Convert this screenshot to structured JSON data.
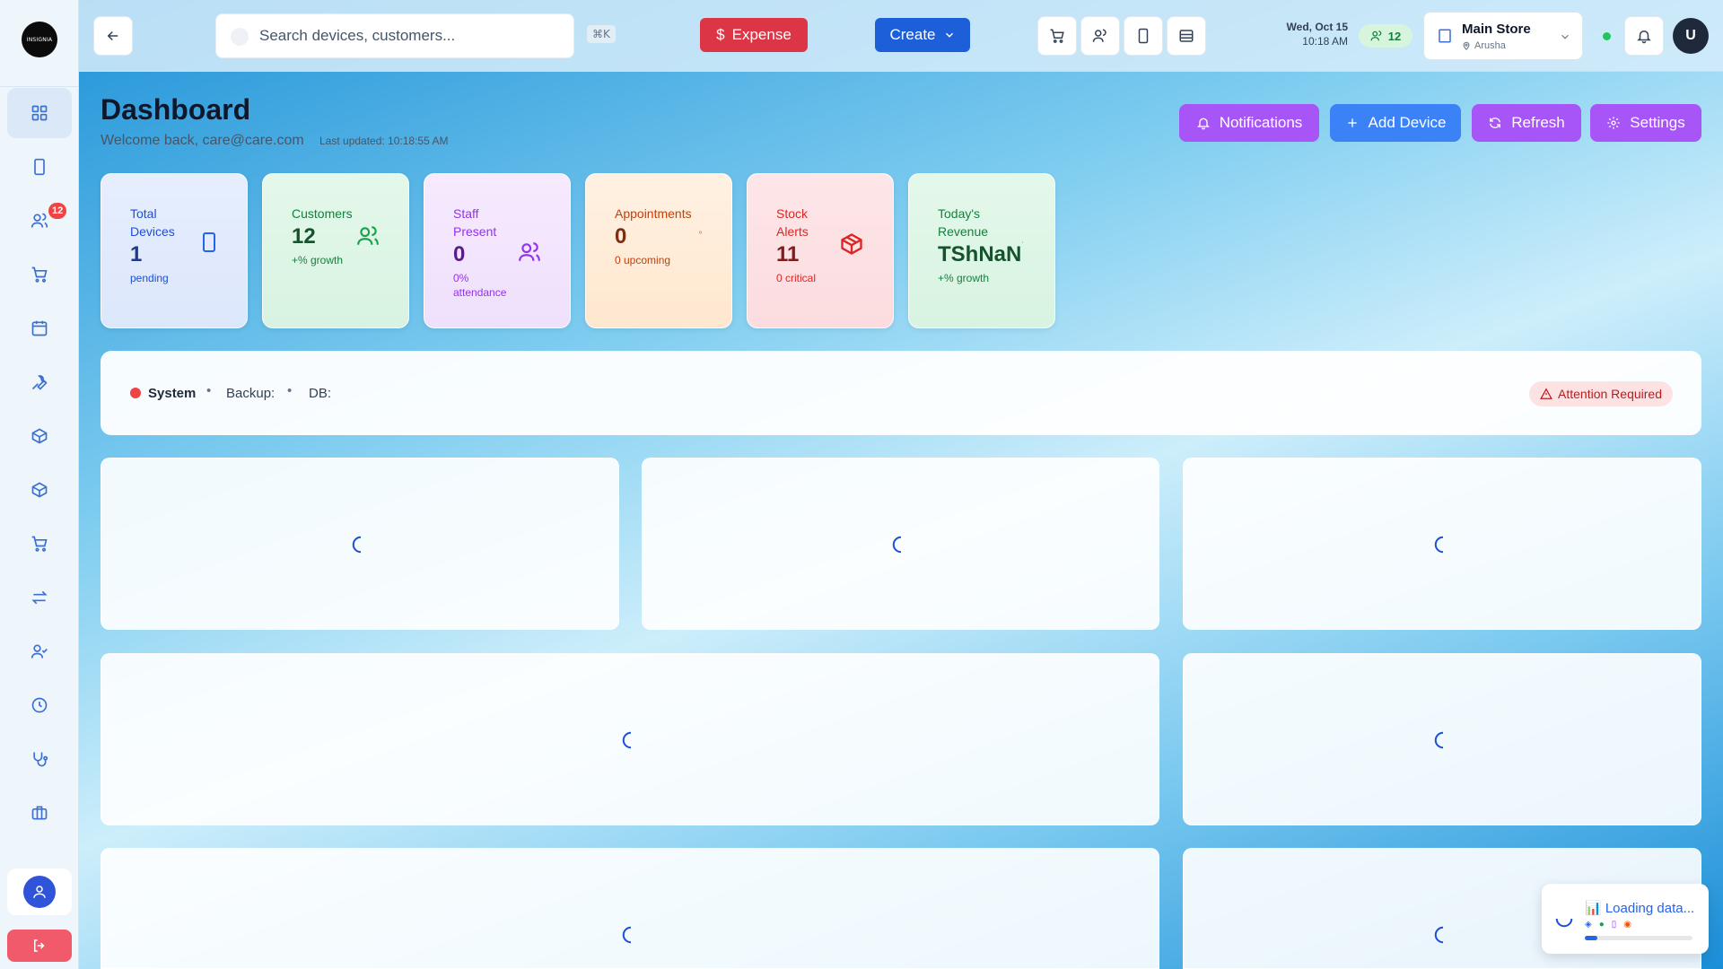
{
  "sidebar": {
    "logo_text": "INSIGNIA",
    "items": [
      {
        "icon": "dashboard-grid-icon",
        "active": true
      },
      {
        "icon": "smartphone-icon"
      },
      {
        "icon": "users-icon",
        "badge": "12"
      },
      {
        "icon": "shopping-cart-icon"
      },
      {
        "icon": "calendar-icon"
      },
      {
        "icon": "wrench-icon"
      },
      {
        "icon": "package-icon"
      },
      {
        "icon": "box-icon"
      },
      {
        "icon": "cart-icon"
      },
      {
        "icon": "transfer-arrows-icon"
      },
      {
        "icon": "user-check-icon"
      },
      {
        "icon": "clock-icon"
      },
      {
        "icon": "stethoscope-icon"
      },
      {
        "icon": "briefcase-icon"
      }
    ]
  },
  "topbar": {
    "search_placeholder": "Search devices, customers...",
    "shortcut": "⌘K",
    "expense_label": "Expense",
    "create_label": "Create",
    "date": "Wed, Oct 15",
    "time": "10:18 AM",
    "online_count": "12",
    "store_name": "Main Store",
    "store_location": "Arusha",
    "user_initial": "U"
  },
  "header": {
    "title": "Dashboard",
    "welcome": "Welcome back, care@care.com",
    "last_updated": "Last updated: 10:18:55 AM",
    "actions": {
      "notifications": "Notifications",
      "add_device": "Add Device",
      "refresh": "Refresh",
      "settings": "Settings"
    }
  },
  "stats": {
    "devices": {
      "label": "Total Devices",
      "value": "1",
      "sub": "pending"
    },
    "customers": {
      "label": "Customers",
      "value": "12",
      "sub": "+% growth"
    },
    "staff": {
      "label": "Staff Present",
      "value": "0",
      "sub": "0% attendance"
    },
    "appointments": {
      "label": "Appointments",
      "value": "0",
      "sub": "0 upcoming"
    },
    "stock": {
      "label": "Stock Alerts",
      "value": "11",
      "sub": "0 critical"
    },
    "revenue": {
      "label": "Today's Revenue",
      "value": "TShNaN",
      "sub": "+% growth"
    }
  },
  "system": {
    "status_label": "System",
    "backup_label": "Backup:",
    "db_label": "DB:",
    "alert": "Attention Required",
    "status_color": "#ef4444"
  },
  "loading": {
    "text": "📊 Loading data...",
    "progress": 0.12
  }
}
